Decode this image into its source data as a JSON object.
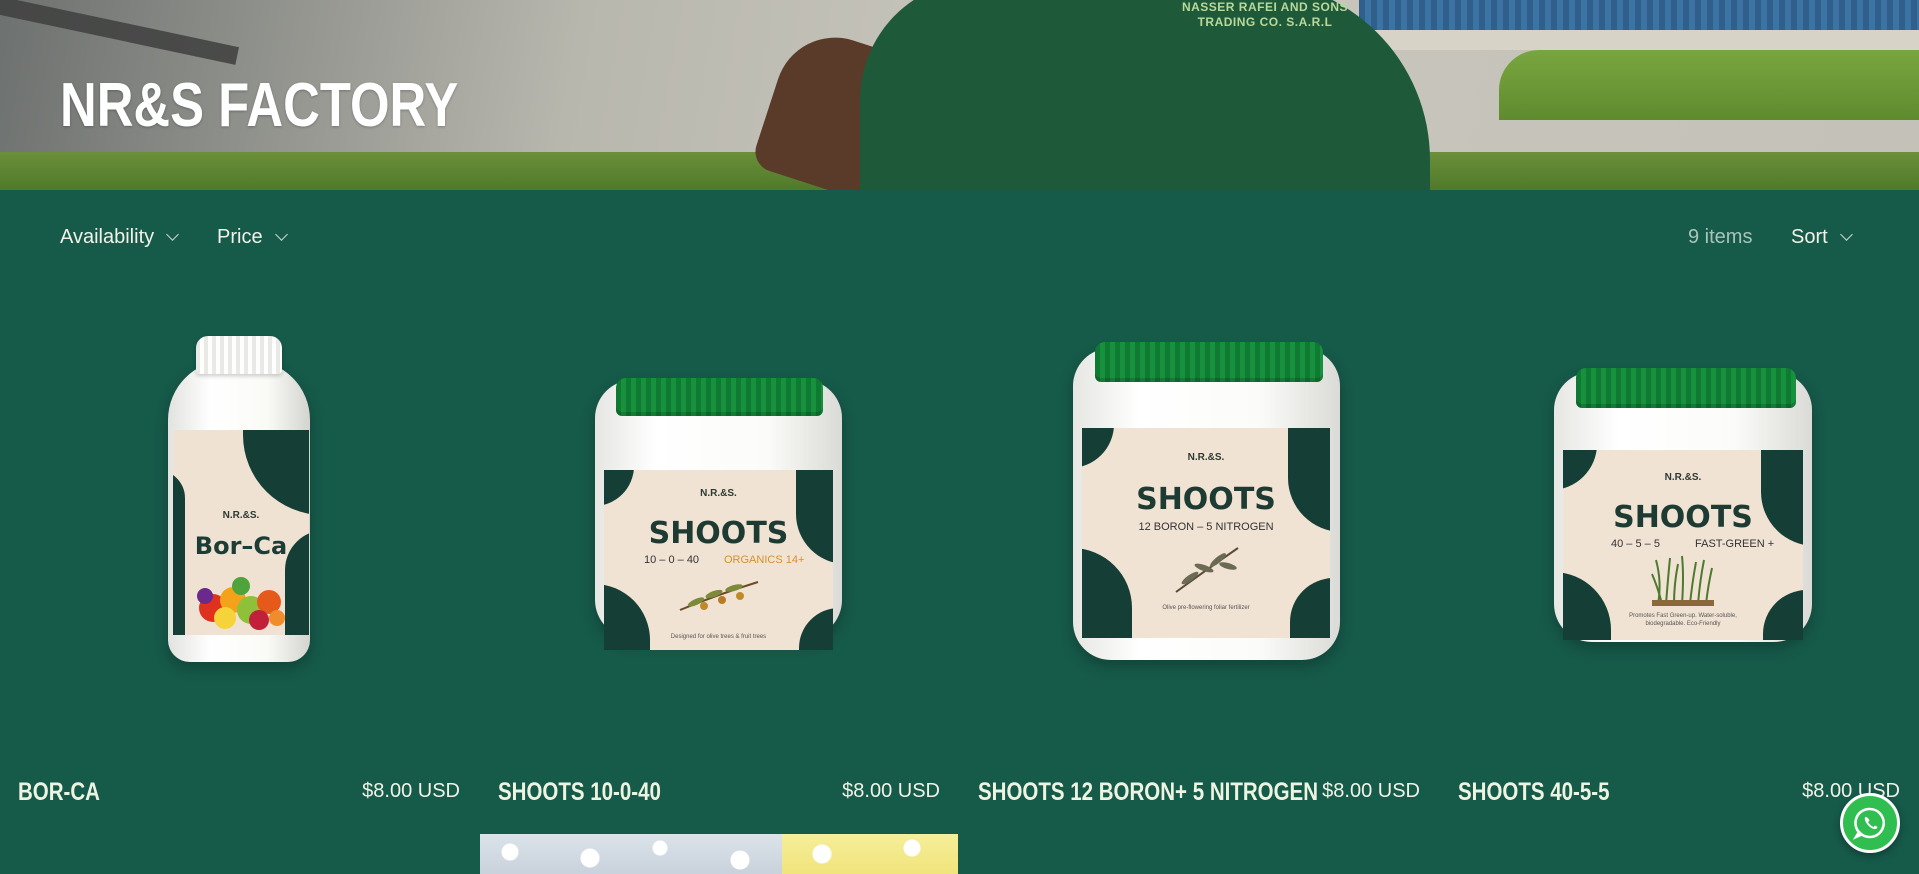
{
  "hero": {
    "title": "NR&S FACTORY",
    "shirt_text_line1": "NASSER RAFEI AND SONS",
    "shirt_text_line2": "TRADING CO. S.A.R.L"
  },
  "filters": {
    "availability_label": "Availability",
    "price_label": "Price",
    "items_count": "9 items",
    "sort_label": "Sort"
  },
  "products": [
    {
      "name": "BOR-CA",
      "price": "$8.00 USD",
      "label_brand": "N.R.&S.",
      "label_title": "Bor–Ca",
      "image_type": "bottle"
    },
    {
      "name": "SHOOTS 10-0-40",
      "price": "$8.00 USD",
      "label_brand": "N.R.&S.",
      "label_title": "SHOOTS",
      "label_formula": "10 – 0 – 40",
      "label_variant": "ORGANICS 14+",
      "label_note": "Designed for olive trees & fruit trees",
      "image_type": "jar"
    },
    {
      "name": "SHOOTS 12 BORON+ 5 NITROGEN",
      "price": "$8.00 USD",
      "label_brand": "N.R.&S.",
      "label_title": "SHOOTS",
      "label_formula": "12 BORON – 5 NITROGEN",
      "label_note": "Olive pre-flowering foliar fertilizer",
      "image_type": "jar"
    },
    {
      "name": "SHOOTS 40-5-5",
      "price": "$8.00 USD",
      "label_brand": "N.R.&S.",
      "label_title": "SHOOTS",
      "label_formula": "40 – 5 – 5",
      "label_variant": "FAST-GREEN +",
      "label_note": "Promotes Fast Green-up. Water-soluble, biodegradable. Eco-Friendly",
      "image_type": "jar"
    }
  ],
  "colors": {
    "background": "#165a4a",
    "text": "#f1f2e6",
    "muted_text": "#a9c4b8",
    "whatsapp": "#2fbe4f"
  },
  "icons": {
    "availability_chevron": "chevron-down-icon",
    "price_chevron": "chevron-down-icon",
    "sort_chevron": "chevron-down-icon",
    "whatsapp": "whatsapp-icon"
  }
}
